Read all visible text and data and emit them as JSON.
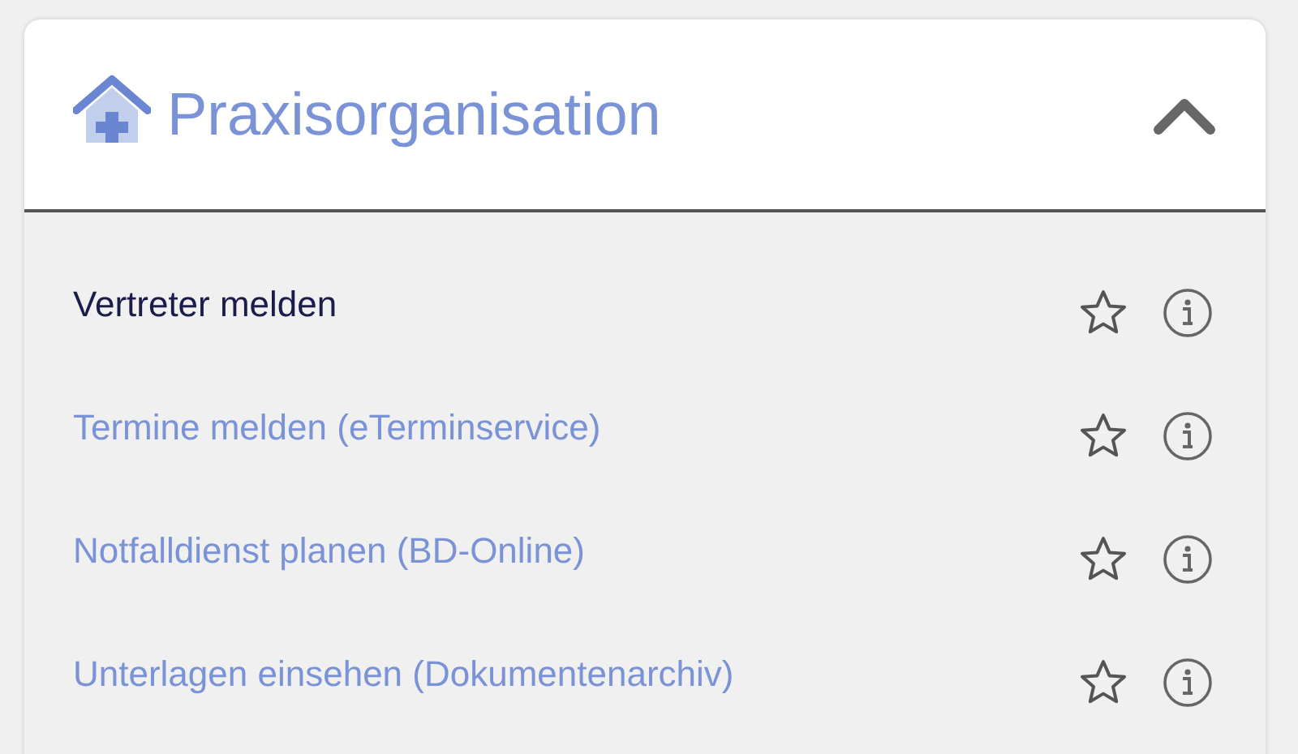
{
  "panel": {
    "title": "Praxisorganisation",
    "expanded": true
  },
  "items": [
    {
      "label": "Vertreter melden",
      "selected": true
    },
    {
      "label": "Termine melden (eTerminservice)",
      "selected": false
    },
    {
      "label": "Notfalldienst planen (BD-Online)",
      "selected": false
    },
    {
      "label": "Unterlagen einsehen (Dokumentenarchiv)",
      "selected": false
    }
  ]
}
